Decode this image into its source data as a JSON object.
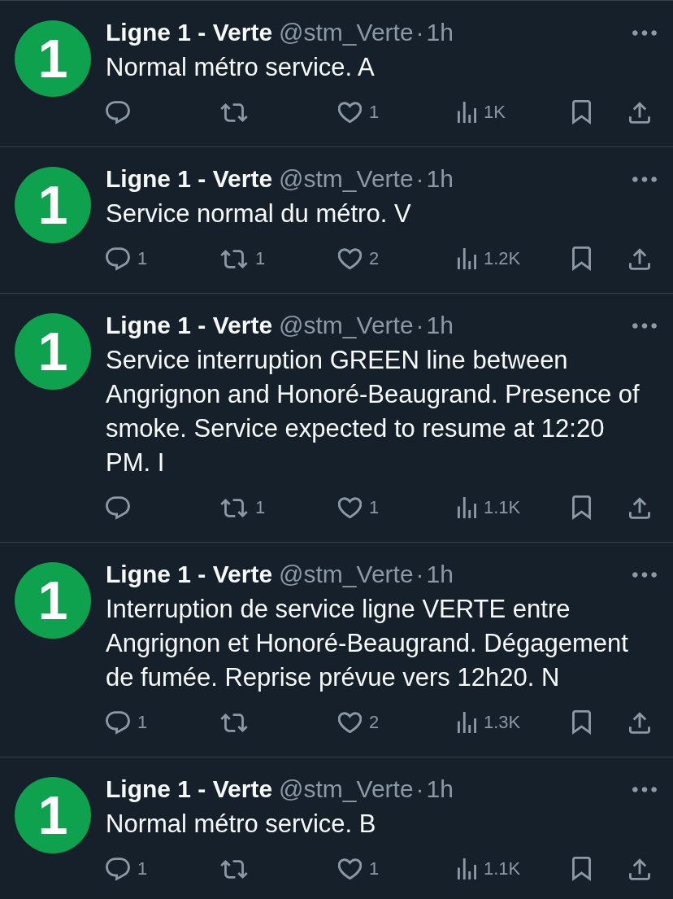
{
  "tweets": [
    {
      "avatar_text": "1",
      "name": "Ligne 1 - Verte",
      "handle": "@stm_Verte",
      "separator": "·",
      "time": "1h",
      "text": "Normal métro service. A",
      "actions": [
        {
          "kind": "reply"
        },
        {
          "kind": "retweet"
        },
        {
          "kind": "like",
          "count": "1"
        },
        {
          "kind": "views",
          "count": "1K"
        },
        {
          "kind": "bookmark"
        },
        {
          "kind": "share"
        }
      ]
    },
    {
      "avatar_text": "1",
      "name": "Ligne 1 - Verte",
      "handle": "@stm_Verte",
      "separator": "·",
      "time": "1h",
      "text": "Service normal du métro. V",
      "actions": [
        {
          "kind": "reply",
          "count": "1"
        },
        {
          "kind": "retweet",
          "count": "1"
        },
        {
          "kind": "like",
          "count": "2"
        },
        {
          "kind": "views",
          "count": "1.2K"
        },
        {
          "kind": "bookmark"
        },
        {
          "kind": "share"
        }
      ]
    },
    {
      "avatar_text": "1",
      "name": "Ligne 1 - Verte",
      "handle": "@stm_Verte",
      "separator": "·",
      "time": "1h",
      "text": "Service interruption GREEN line between Angrignon and Honoré-Beaugrand. Presence of smoke. Service expected to resume at 12:20 PM. I",
      "actions": [
        {
          "kind": "reply"
        },
        {
          "kind": "retweet",
          "count": "1"
        },
        {
          "kind": "like",
          "count": "1"
        },
        {
          "kind": "views",
          "count": "1.1K"
        },
        {
          "kind": "bookmark"
        },
        {
          "kind": "share"
        }
      ]
    },
    {
      "avatar_text": "1",
      "name": "Ligne 1 - Verte",
      "handle": "@stm_Verte",
      "separator": "·",
      "time": "1h",
      "text": "Interruption de service ligne VERTE entre Angrignon et Honoré-Beaugrand. Dégagement de fumée. Reprise prévue vers 12h20. N",
      "actions": [
        {
          "kind": "reply",
          "count": "1"
        },
        {
          "kind": "retweet"
        },
        {
          "kind": "like",
          "count": "2"
        },
        {
          "kind": "views",
          "count": "1.3K"
        },
        {
          "kind": "bookmark"
        },
        {
          "kind": "share"
        }
      ]
    },
    {
      "avatar_text": "1",
      "name": "Ligne 1 - Verte",
      "handle": "@stm_Verte",
      "separator": "·",
      "time": "1h",
      "text": "Normal métro service. B",
      "actions": [
        {
          "kind": "reply",
          "count": "1"
        },
        {
          "kind": "retweet"
        },
        {
          "kind": "like",
          "count": "1"
        },
        {
          "kind": "views",
          "count": "1.1K"
        },
        {
          "kind": "bookmark"
        },
        {
          "kind": "share"
        }
      ]
    }
  ]
}
